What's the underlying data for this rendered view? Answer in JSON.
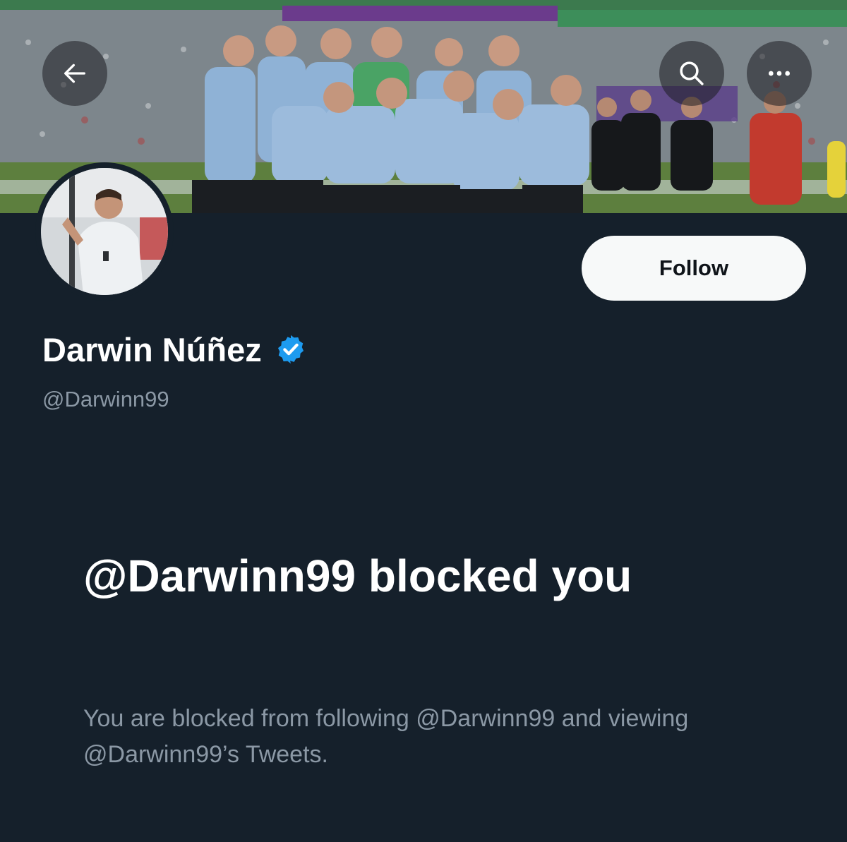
{
  "header": {
    "back_icon": "arrow-left-icon",
    "search_icon": "search-icon",
    "more_icon": "more-dots-icon"
  },
  "profile": {
    "display_name": "Darwin Núñez",
    "handle": "@Darwinn99",
    "verified": true,
    "follow_label": "Follow"
  },
  "blocked": {
    "title": "@Darwinn99 blocked you",
    "description": "You are blocked from following @Darwinn99 and viewing @Darwinn99’s Tweets."
  },
  "colors": {
    "background": "#15202b",
    "secondary_text": "#8b98a5",
    "verified_badge": "#1d9bf0",
    "follow_button_bg": "#f7f9f9"
  }
}
